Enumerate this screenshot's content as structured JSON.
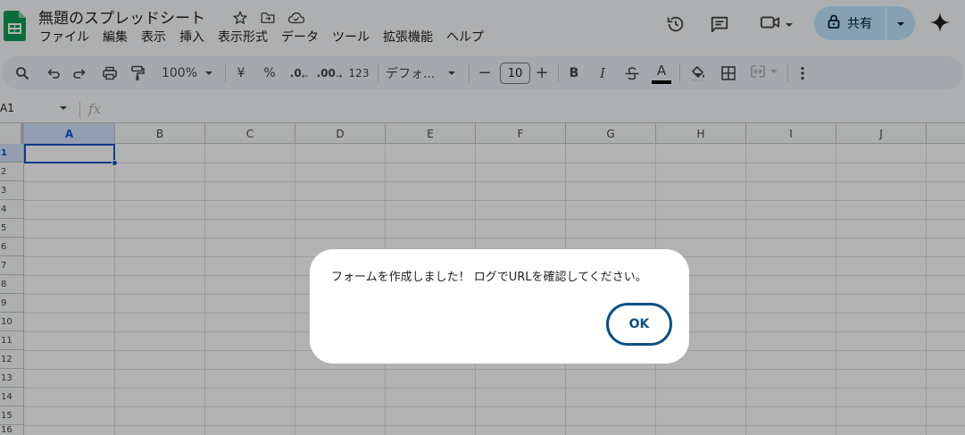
{
  "app": {
    "doc_title": "無題のスプレッドシート",
    "menu": [
      "ファイル",
      "編集",
      "表示",
      "挿入",
      "表示形式",
      "データ",
      "ツール",
      "拡張機能",
      "ヘルプ"
    ],
    "share_label": "共有",
    "accent_color": "#c2e7ff",
    "brand_color": "#0f9d58"
  },
  "title_icons": [
    "star-icon",
    "move-to-folder-icon",
    "cloud-saved-icon"
  ],
  "toolbar": {
    "zoom": "100%",
    "currency_symbol": "¥",
    "percent_symbol": "%",
    "decrease_decimal": ".0",
    "increase_decimal": ".00",
    "number_format": "123",
    "font_name": "デフォ...",
    "font_size": "10",
    "minus": "−",
    "plus": "+",
    "bold": "B",
    "italic": "I",
    "text_color_letter": "A"
  },
  "formula_bar": {
    "name_box": "A1",
    "fx_label": "fx"
  },
  "grid": {
    "columns": [
      "A",
      "B",
      "C",
      "D",
      "E",
      "F",
      "G",
      "H",
      "I",
      "J"
    ],
    "rows": [
      "1",
      "2",
      "3",
      "4",
      "5",
      "6",
      "7",
      "8",
      "9",
      "10",
      "11",
      "12",
      "13",
      "14",
      "15",
      "16"
    ],
    "selected_cell": "A1"
  },
  "dialog": {
    "message": "フォームを作成しました！ ログでURLを確認してください。",
    "ok_label": "OK"
  }
}
